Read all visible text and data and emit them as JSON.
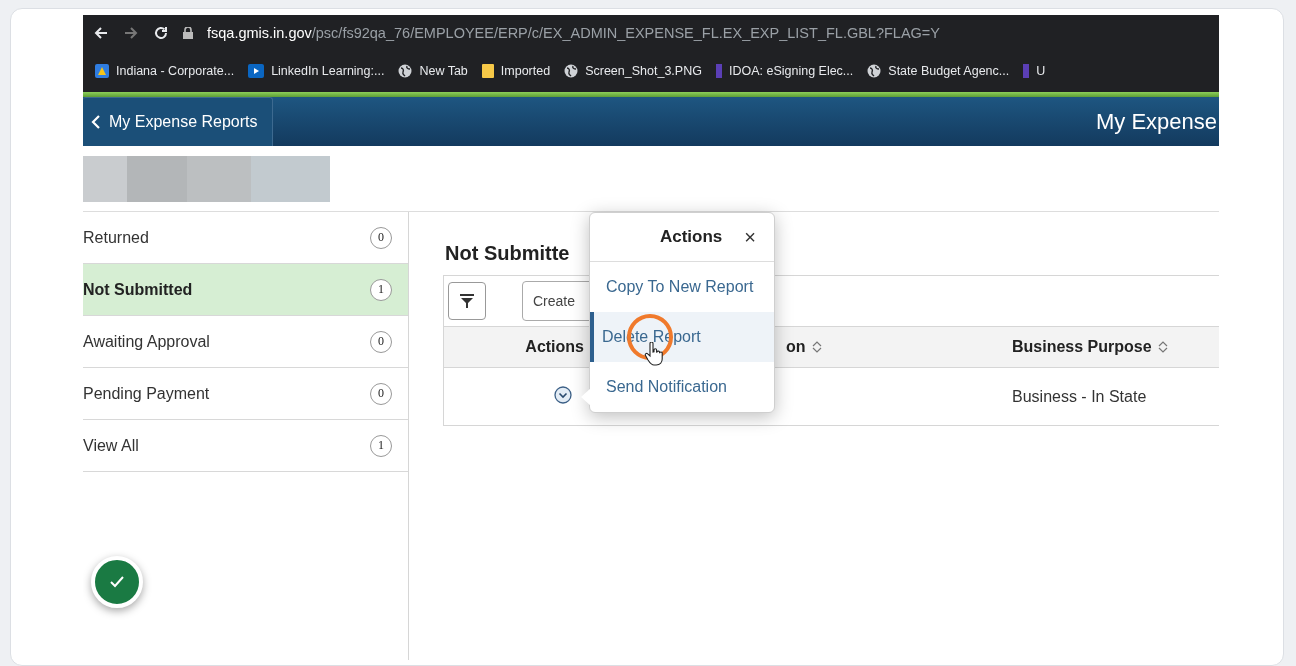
{
  "browser": {
    "url_host": "fsqa.gmis.in.gov",
    "url_path": "/psc/fs92qa_76/EMPLOYEE/ERP/c/EX_ADMIN_EXPENSE_FL.EX_EXP_LIST_FL.GBL?FLAG=Y",
    "bookmarks": [
      {
        "label": "Indiana - Corporate...",
        "kind": "app"
      },
      {
        "label": "LinkedIn Learning:...",
        "kind": "video"
      },
      {
        "label": "New Tab",
        "kind": "globe"
      },
      {
        "label": "Imported",
        "kind": "folder"
      },
      {
        "label": "Screen_Shot_3.PNG",
        "kind": "globe"
      },
      {
        "label": "IDOA: eSigning Elec...",
        "kind": "tag"
      },
      {
        "label": "State Budget Agenc...",
        "kind": "globe"
      },
      {
        "label": "U",
        "kind": "tag"
      }
    ]
  },
  "header": {
    "back_label": "My Expense Reports",
    "title": "My Expense"
  },
  "sidebar": {
    "items": [
      {
        "label": "Returned",
        "count": "0",
        "selected": false
      },
      {
        "label": "Not Submitted",
        "count": "1",
        "selected": true
      },
      {
        "label": "Awaiting Approval",
        "count": "0",
        "selected": false
      },
      {
        "label": "Pending Payment",
        "count": "0",
        "selected": false
      },
      {
        "label": "View All",
        "count": "1",
        "selected": false
      }
    ]
  },
  "content": {
    "heading": "Not Submitte",
    "search": {
      "placeholder": "Create"
    },
    "table": {
      "columns": [
        "Actions",
        "on",
        "Business Purpose"
      ],
      "sortable": [
        false,
        true,
        true
      ],
      "rows": [
        [
          "",
          "",
          "Business - In State"
        ]
      ]
    }
  },
  "popup": {
    "title": "Actions",
    "close": "×",
    "items": [
      {
        "label": "Copy To New Report",
        "selected": false
      },
      {
        "label": "Delete Report",
        "selected": true
      },
      {
        "label": "Send Notification",
        "selected": false
      }
    ]
  }
}
